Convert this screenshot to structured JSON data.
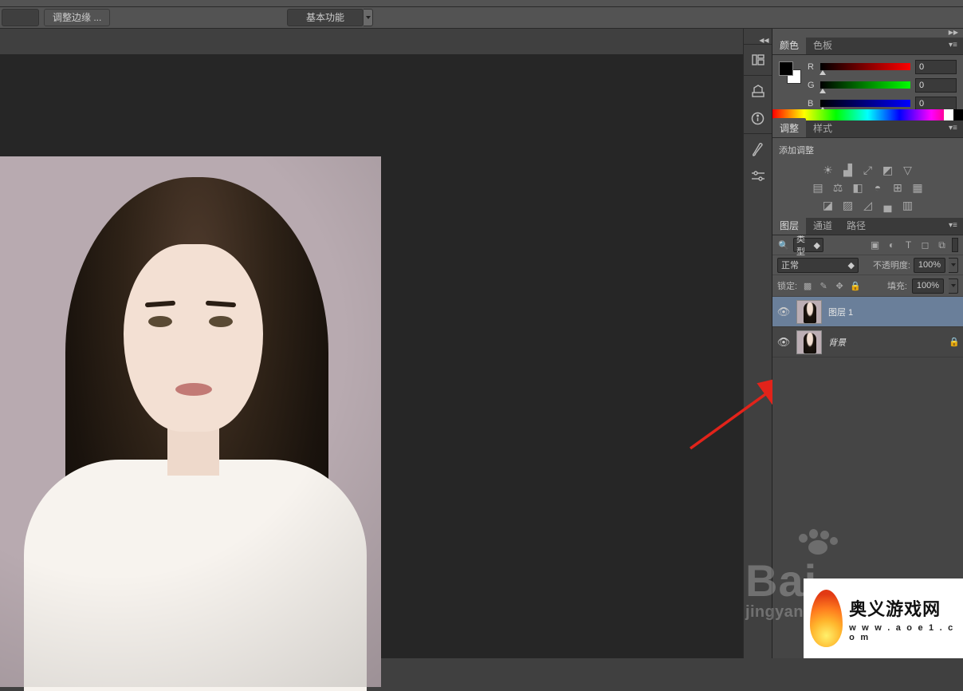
{
  "optionsBar": {
    "refineEdge": "调整边缘 ...",
    "workspace": "基本功能"
  },
  "panels": {
    "color": {
      "tabs": [
        "颜色",
        "色板"
      ],
      "channels": {
        "r_label": "R",
        "g_label": "G",
        "b_label": "B",
        "r": "0",
        "g": "0",
        "b": "0"
      }
    },
    "adjustments": {
      "tabs": [
        "调整",
        "样式"
      ],
      "addLabel": "添加调整"
    },
    "layers": {
      "tabs": [
        "图层",
        "通道",
        "路径"
      ],
      "kind": "类型",
      "blendMode": "正常",
      "opacityLabel": "不透明度:",
      "opacityValue": "100%",
      "lockLabel": "锁定:",
      "fillLabel": "填充:",
      "fillValue": "100%",
      "items": [
        {
          "name": "图层 1",
          "visible": true,
          "locked": false,
          "selected": true
        },
        {
          "name": "背景",
          "visible": true,
          "locked": true,
          "selected": false,
          "italic": true
        }
      ]
    }
  },
  "watermark": {
    "brand": "Bai",
    "sub": "jingyan"
  },
  "badge": {
    "title": "奥义游戏网",
    "url": "w w w . a o e 1 . c o m"
  }
}
